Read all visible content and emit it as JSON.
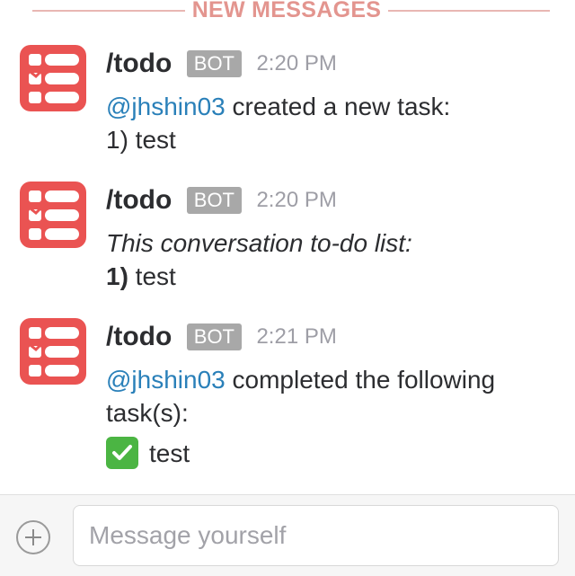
{
  "divider": {
    "label": "NEW MESSAGES"
  },
  "colors": {
    "avatar": "#ea5352",
    "mention": "#2a80b9",
    "divider": "#e3958f",
    "badge": "#a8a8a8",
    "check": "#4bb543"
  },
  "messages": [
    {
      "sender": "/todo",
      "badge": "BOT",
      "time": "2:20 PM",
      "avatar_icon": "todo-list-icon",
      "line1": {
        "mention": "@jhshin03",
        "text": " created a new task:"
      },
      "line2": {
        "text": "1) test"
      }
    },
    {
      "sender": "/todo",
      "badge": "BOT",
      "time": "2:20 PM",
      "avatar_icon": "todo-list-icon",
      "line1": {
        "text": "This conversation to-do list:"
      },
      "line2": {
        "number": "1)",
        "text": " test"
      }
    },
    {
      "sender": "/todo",
      "badge": "BOT",
      "time": "2:21 PM",
      "avatar_icon": "todo-list-icon",
      "line1": {
        "mention": "@jhshin03",
        "text": " completed the following task(s):"
      },
      "line2": {
        "icon": "check-mark-icon",
        "text": "test"
      }
    }
  ],
  "composer": {
    "add_icon": "plus-icon",
    "placeholder": "Message yourself",
    "value": ""
  }
}
